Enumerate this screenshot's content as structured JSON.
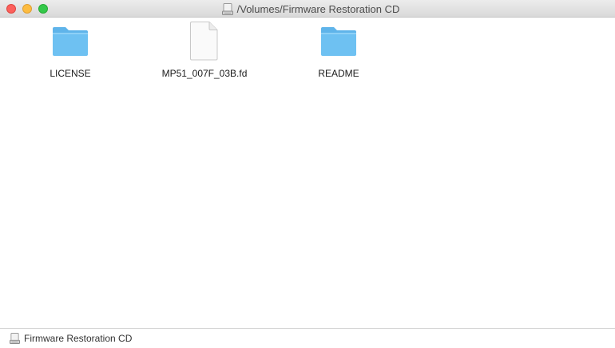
{
  "window": {
    "title": "/Volumes/Firmware Restoration CD"
  },
  "items": [
    {
      "label": "LICENSE",
      "icon": "folder-icon"
    },
    {
      "label": "MP51_007F_03B.fd",
      "icon": "document-icon"
    },
    {
      "label": "README",
      "icon": "folder-icon"
    }
  ],
  "status": {
    "label": "Firmware Restoration CD",
    "icon": "disk-drive-icon"
  },
  "colors": {
    "folder": "#6ec1f2",
    "close": "#fc605c",
    "minimize": "#fdbc40",
    "zoom": "#34c84a"
  }
}
